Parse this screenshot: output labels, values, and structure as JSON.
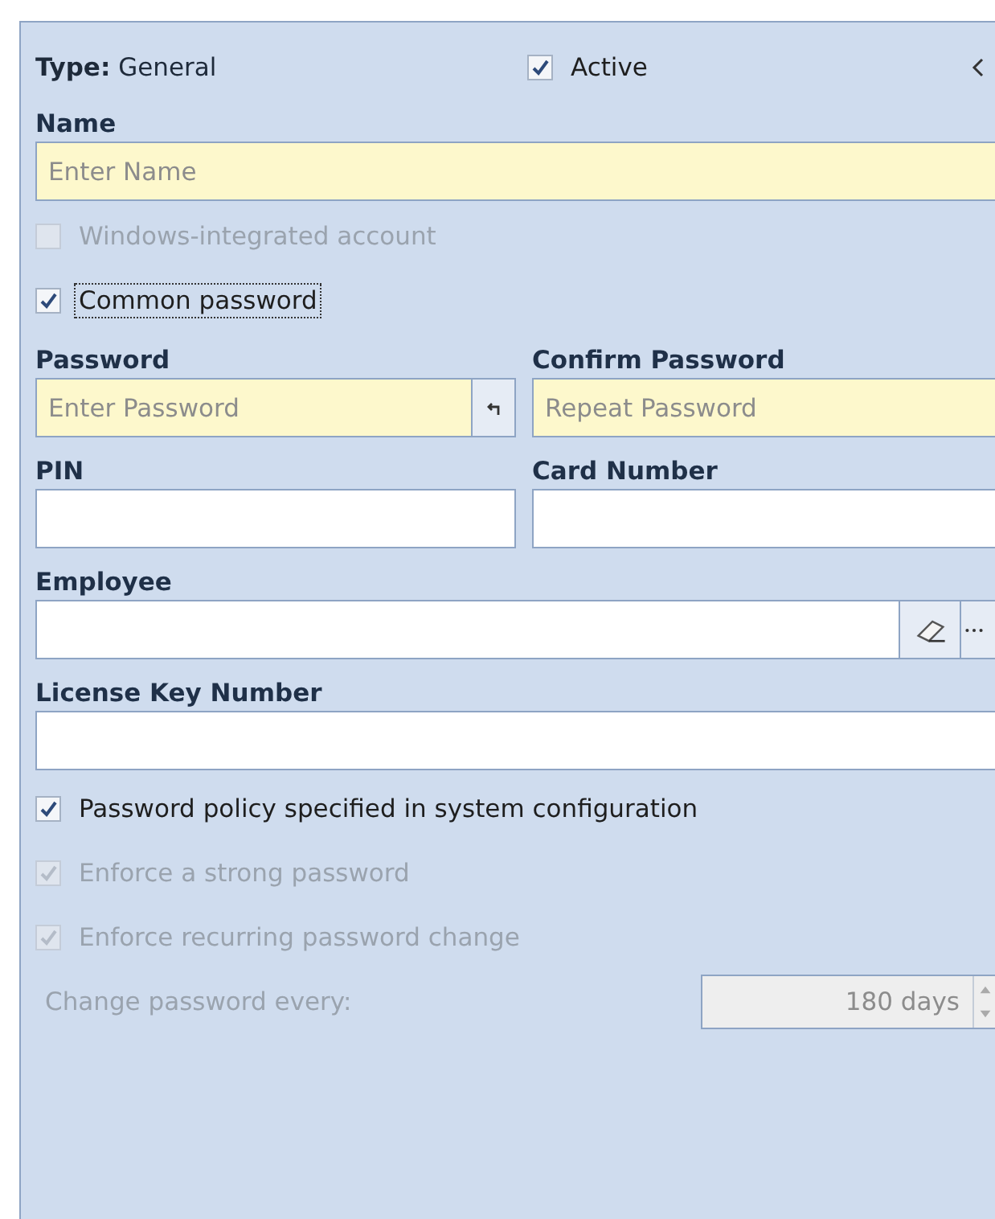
{
  "header": {
    "type_label": "Type:",
    "type_value": "General",
    "active": {
      "label": "Active",
      "checked": true,
      "disabled": false,
      "focused": false
    }
  },
  "name": {
    "label": "Name",
    "placeholder": "Enter Name",
    "required": true
  },
  "account_options": [
    {
      "label": "Windows-integrated account",
      "checked": false,
      "disabled": true,
      "focused": false
    },
    {
      "label": "Common password",
      "checked": true,
      "disabled": false,
      "focused": true
    }
  ],
  "password": {
    "label": "Password",
    "placeholder": "Enter Password",
    "required": true
  },
  "confirm_password": {
    "label": "Confirm Password",
    "placeholder": "Repeat Password",
    "required": true
  },
  "pin": {
    "label": "PIN",
    "required": false
  },
  "card_number": {
    "label": "Card Number",
    "required": false
  },
  "employee": {
    "label": "Employee",
    "required": false
  },
  "license_key": {
    "label": "License Key Number",
    "required": false
  },
  "policy_options": [
    {
      "label": "Password policy specified in system configuration",
      "checked": true,
      "disabled": false,
      "focused": false
    },
    {
      "label": "Enforce a strong password",
      "checked": true,
      "disabled": true,
      "focused": false
    },
    {
      "label": "Enforce recurring password change",
      "checked": true,
      "disabled": true,
      "focused": false
    }
  ],
  "change_interval": {
    "label": "Change password every:",
    "value": "180 days",
    "disabled": true
  }
}
